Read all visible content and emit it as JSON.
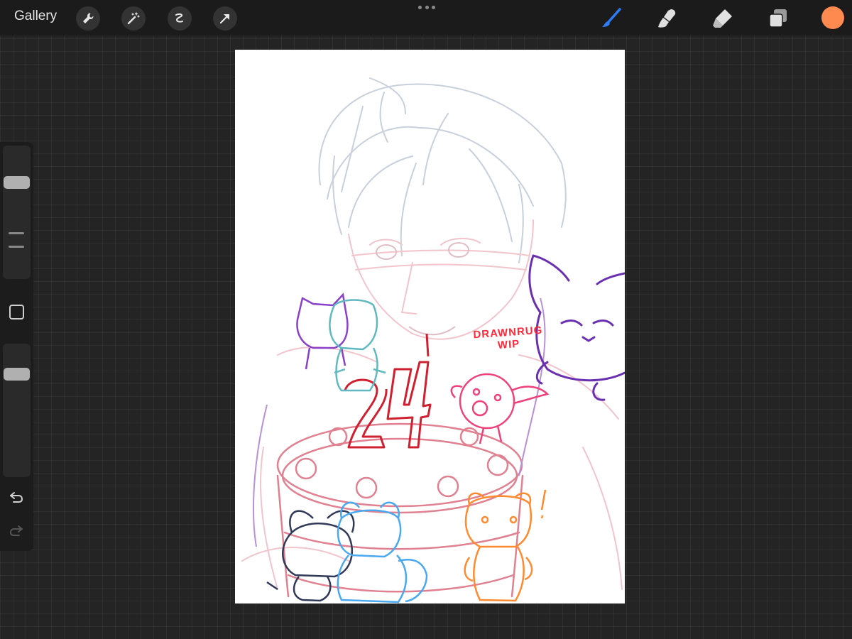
{
  "toolbar": {
    "gallery_label": "Gallery",
    "left_tools": [
      {
        "name": "wrench-icon",
        "label": "Actions"
      },
      {
        "name": "magic-wand-icon",
        "label": "Adjustments"
      },
      {
        "name": "selection-icon",
        "label": "Selection"
      },
      {
        "name": "transform-arrow-icon",
        "label": "Transform"
      }
    ],
    "right_tools": [
      {
        "name": "brush-icon",
        "label": "Paint",
        "active": true
      },
      {
        "name": "smudge-icon",
        "label": "Smudge"
      },
      {
        "name": "eraser-icon",
        "label": "Erase"
      },
      {
        "name": "layers-icon",
        "label": "Layers"
      }
    ],
    "current_color": "#ff8a50",
    "accent_color": "#2d7cf6"
  },
  "sidebar": {
    "brush_size_level": 0.25,
    "opacity_level": 0.2,
    "undo_icon": "undo-icon",
    "redo_icon": "redo-icon"
  },
  "canvas": {
    "handwritten_text": "DRAWNRUG WIP",
    "candle_number": "24"
  }
}
